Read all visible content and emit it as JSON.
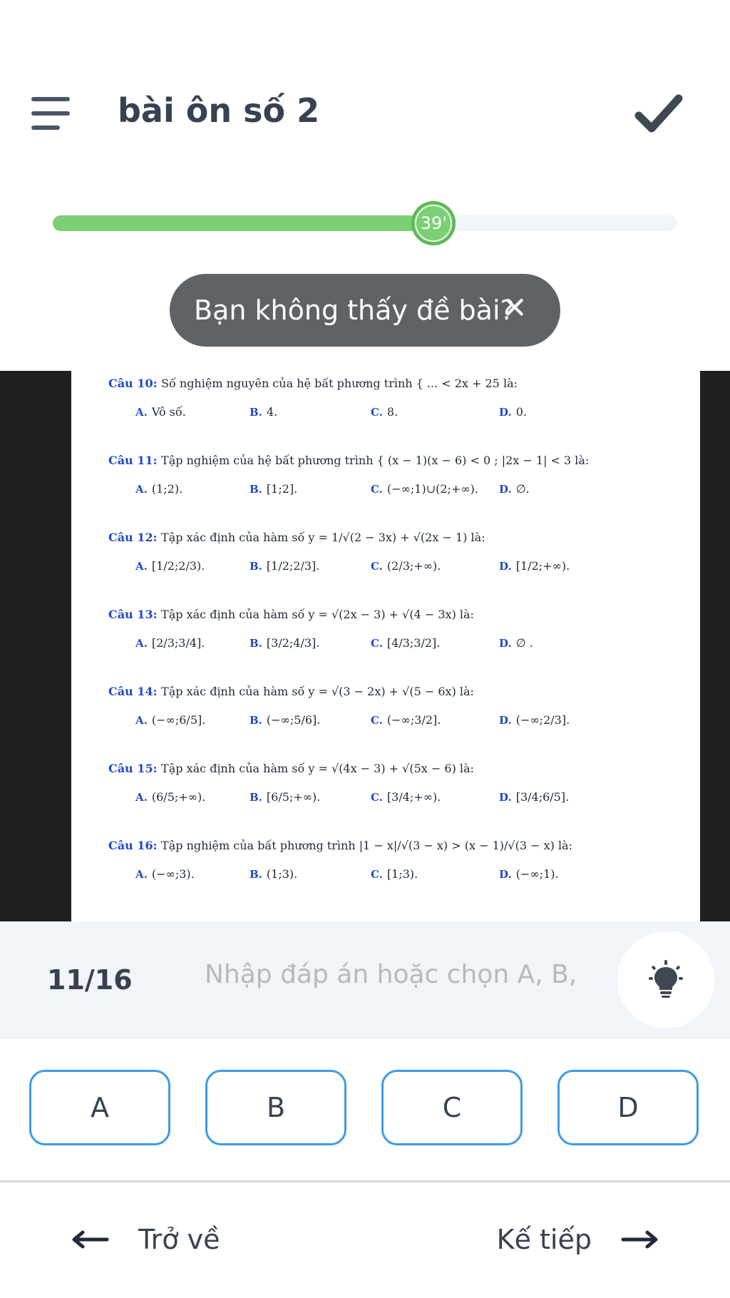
{
  "header": {
    "title": "bài ôn số 2",
    "menu_icon": "hamburger-menu-icon",
    "submit_icon": "checkmark-icon"
  },
  "timer": {
    "label": "39'",
    "progress": 0.61
  },
  "toast": {
    "text": "Bạn không thấy đề bài?",
    "close_glyph": "✕"
  },
  "document": {
    "questions": [
      {
        "number": "Câu 10:",
        "text": "Số nghiệm nguyên của hệ bất phương trình { ... < 2x + 25 là:",
        "options": [
          "Vô số.",
          "4.",
          "8.",
          "0."
        ]
      },
      {
        "number": "Câu 11:",
        "text": "Tập nghiệm của hệ bất phương trình { (x − 1)(x − 6) < 0 ; |2x − 1| < 3 là:",
        "options": [
          "(1;2).",
          "[1;2].",
          "(−∞;1)∪(2;+∞).",
          "∅."
        ]
      },
      {
        "number": "Câu 12:",
        "text": "Tập xác định của hàm số y = 1/√(2 − 3x) + √(2x − 1) là:",
        "options": [
          "[1/2;2/3).",
          "[1/2;2/3].",
          "(2/3;+∞).",
          "[1/2;+∞)."
        ]
      },
      {
        "number": "Câu 13:",
        "text": "Tập xác định của hàm số y = √(2x − 3) + √(4 − 3x) là:",
        "options": [
          "[2/3;3/4].",
          "[3/2;4/3].",
          "[4/3;3/2].",
          "∅ ."
        ]
      },
      {
        "number": "Câu 14:",
        "text": "Tập xác định của hàm số y = √(3 − 2x) + √(5 − 6x) là:",
        "options": [
          "(−∞;6/5].",
          "(−∞;5/6].",
          "(−∞;3/2].",
          "(−∞;2/3]."
        ]
      },
      {
        "number": "Câu 15:",
        "text": "Tập xác định của hàm số y = √(4x − 3) + √(5x − 6) là:",
        "options": [
          "(6/5;+∞).",
          "[6/5;+∞).",
          "[3/4;+∞).",
          "[3/4;6/5]."
        ]
      },
      {
        "number": "Câu 16:",
        "text": "Tập nghiệm của bất phương trình |1 − x|/√(3 − x) > (x − 1)/√(3 − x) là:",
        "options": [
          "(−∞;3).",
          "(1;3).",
          "[1;3).",
          "(−∞;1)."
        ]
      }
    ],
    "option_letters": [
      "A.",
      "B.",
      "C.",
      "D."
    ]
  },
  "answer": {
    "counter": "11/16",
    "placeholder": "Nhập đáp án hoặc chọn A, B,",
    "hint_icon": "lightbulb-icon"
  },
  "choices": [
    "A",
    "B",
    "C",
    "D"
  ],
  "nav": {
    "back_label": "Trở về",
    "next_label": "Kế tiếp"
  },
  "colors": {
    "accent_green": "#7ccf74",
    "choice_border": "#3b9be8",
    "question_blue": "#1f49c8",
    "toast_bg": "#5f6368"
  }
}
